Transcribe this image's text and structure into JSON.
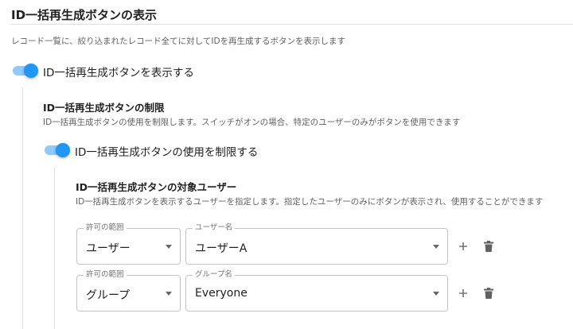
{
  "section": {
    "title": "ID一括再生成ボタンの表示",
    "description": "レコード一覧に、絞り込まれたレコード全てに対してIDを再生成するボタンを表示します"
  },
  "show_toggle": {
    "label": "ID一括再生成ボタンを表示する",
    "checked": true
  },
  "restriction": {
    "title": "ID一括再生成ボタンの制限",
    "description": "ID一括再生成ボタンの使用を制限します。スイッチがオンの場合、特定のユーザーのみがボタンを使用できます",
    "toggle_label": "ID一括再生成ボタンの使用を制限する",
    "checked": true
  },
  "target_users": {
    "title": "ID一括再生成ボタンの対象ユーザー",
    "description": "ID一括再生成ボタンを表示するユーザーを指定します。指定したユーザーのみにボタンが表示され、使用することができます",
    "rows": [
      {
        "scope_legend": "許可の範囲",
        "scope_value": "ユーザー",
        "target_legend": "ユーザー名",
        "target_value": "ユーザーA"
      },
      {
        "scope_legend": "許可の範囲",
        "scope_value": "グループ",
        "target_legend": "グループ名",
        "target_value": "Everyone"
      }
    ]
  },
  "icons": {
    "add": "plus-icon",
    "delete": "trash-icon"
  },
  "colors": {
    "accent": "#2196f3",
    "accent_light": "#90caf9",
    "border": "#c4c4c4"
  }
}
